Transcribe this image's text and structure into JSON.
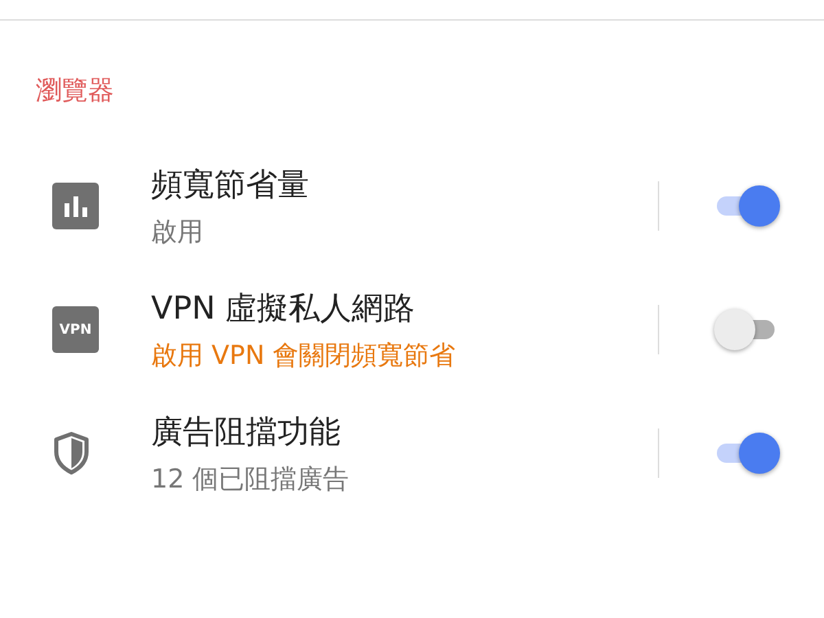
{
  "section": {
    "title": "瀏覽器"
  },
  "settings": [
    {
      "kind": "bars",
      "title": "頻寬節省量",
      "subtitle": "啟用",
      "warning": false,
      "on": true
    },
    {
      "kind": "vpn",
      "icon_text": "VPN",
      "title": "VPN 虛擬私人網路",
      "subtitle": "啟用 VPN 會關閉頻寬節省",
      "warning": true,
      "on": false
    },
    {
      "kind": "shield",
      "title": "廣告阻擋功能",
      "subtitle": "12 個已阻擋廣告",
      "warning": false,
      "on": true
    }
  ]
}
